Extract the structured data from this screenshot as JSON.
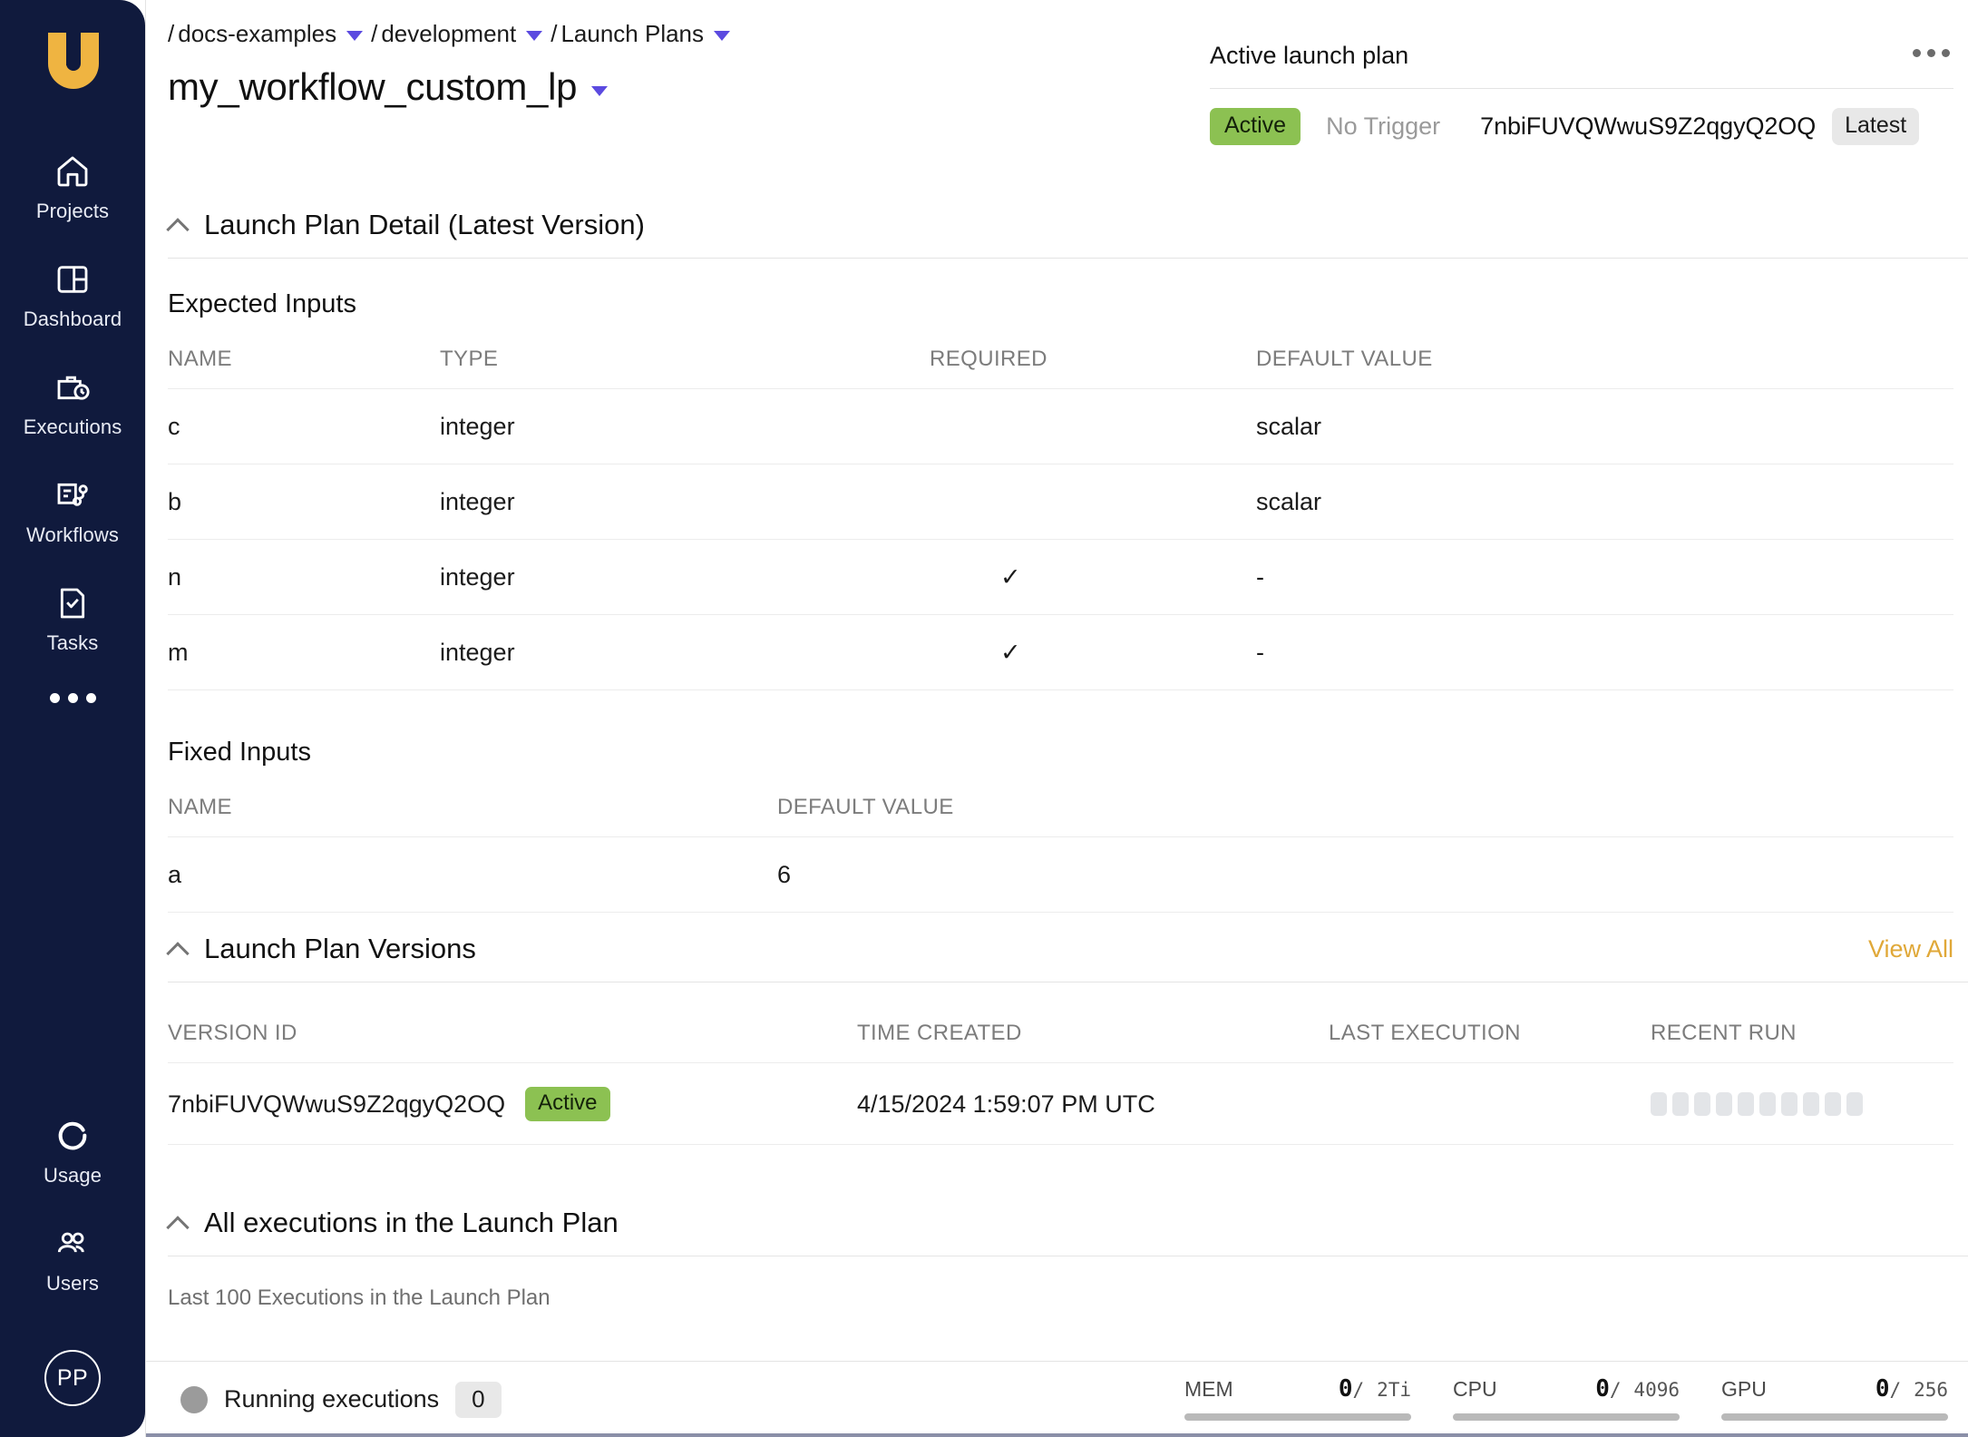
{
  "sidebar": {
    "logo_name": "union-logo",
    "items": [
      {
        "label": "Projects",
        "icon": "home-icon"
      },
      {
        "label": "Dashboard",
        "icon": "dashboard-icon"
      },
      {
        "label": "Executions",
        "icon": "briefcase-clock-icon"
      },
      {
        "label": "Workflows",
        "icon": "workflow-icon"
      },
      {
        "label": "Tasks",
        "icon": "task-check-icon"
      }
    ],
    "more_icon": "more-dots-icon",
    "bottom_items": [
      {
        "label": "Usage",
        "icon": "usage-donut-icon"
      },
      {
        "label": "Users",
        "icon": "users-icon"
      }
    ],
    "avatar_initials": "PP"
  },
  "breadcrumb": {
    "items": [
      {
        "label": "docs-examples"
      },
      {
        "label": "development"
      },
      {
        "label": "Launch Plans"
      }
    ],
    "separator": "/"
  },
  "header": {
    "title": "my_workflow_custom_lp"
  },
  "active_launch_plan": {
    "title": "Active launch plan",
    "status_badge": "Active",
    "trigger": "No Trigger",
    "version_id": "7nbiFUVQWwuS9Z2qgyQ2OQ",
    "latest_chip": "Latest"
  },
  "detail_section": {
    "title": "Launch Plan Detail (Latest Version)",
    "expected_inputs": {
      "title": "Expected Inputs",
      "columns": [
        "NAME",
        "TYPE",
        "REQUIRED",
        "DEFAULT VALUE"
      ],
      "rows": [
        {
          "name": "c",
          "type": "integer",
          "required": "",
          "default": "scalar"
        },
        {
          "name": "b",
          "type": "integer",
          "required": "",
          "default": "scalar"
        },
        {
          "name": "n",
          "type": "integer",
          "required": "✓",
          "default": "-"
        },
        {
          "name": "m",
          "type": "integer",
          "required": "✓",
          "default": "-"
        }
      ]
    },
    "fixed_inputs": {
      "title": "Fixed Inputs",
      "columns": [
        "NAME",
        "DEFAULT VALUE"
      ],
      "rows": [
        {
          "name": "a",
          "default": "6"
        }
      ]
    }
  },
  "versions_section": {
    "title": "Launch Plan Versions",
    "view_all": "View All",
    "columns": [
      "VERSION ID",
      "TIME CREATED",
      "LAST EXECUTION",
      "RECENT RUN"
    ],
    "rows": [
      {
        "version_id": "7nbiFUVQWwuS9Z2qgyQ2OQ",
        "badge": "Active",
        "time_created": "4/15/2024 1:59:07 PM UTC",
        "last_execution": "",
        "recent_run_bars": 10
      }
    ]
  },
  "executions_section": {
    "title": "All executions in the Launch Plan",
    "note": "Last 100 Executions in the Launch Plan"
  },
  "statusbar": {
    "running_label": "Running executions",
    "running_count": "0",
    "resources": [
      {
        "name": "MEM",
        "used": "0",
        "sep": "/",
        "total": "2Ti",
        "percent": 0
      },
      {
        "name": "CPU",
        "used": "0",
        "sep": "/",
        "total": "4096",
        "percent": 0
      },
      {
        "name": "GPU",
        "used": "0",
        "sep": "/",
        "total": "256",
        "percent": 0
      }
    ]
  },
  "colors": {
    "sidebar_bg": "#101a3d",
    "logo_gold": "#efb441",
    "accent_purple": "#5b4ae0",
    "badge_green": "#8cc152",
    "link_amber": "#e0a838"
  }
}
